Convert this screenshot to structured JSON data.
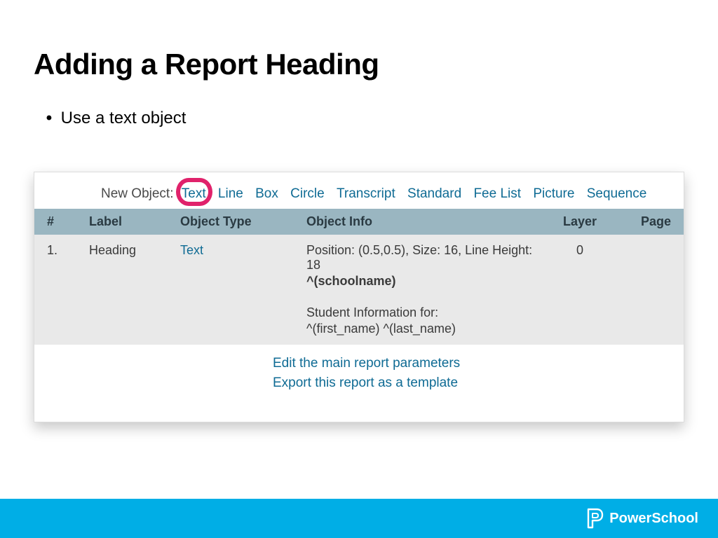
{
  "title": "Adding a Report Heading",
  "bullet": "Use a text object",
  "newObject": {
    "label": "New Object:",
    "types": [
      "Text",
      "Line",
      "Box",
      "Circle",
      "Transcript",
      "Standard",
      "Fee List",
      "Picture",
      "Sequence"
    ],
    "highlighted": "Text"
  },
  "columns": {
    "num": "#",
    "label": "Label",
    "type": "Object Type",
    "info": "Object Info",
    "layer": "Layer",
    "page": "Page"
  },
  "row": {
    "num": "1.",
    "label": "Heading",
    "typeText": "Text",
    "infoLine1": "Position: (0.5,0.5), Size: 16, Line Height: 18",
    "infoTemplate": "^(schoolname)",
    "infoLine3": "Student Information for:",
    "infoLine4": "^(first_name) ^(last_name)",
    "layer": "0",
    "page": ""
  },
  "actions": {
    "edit": "Edit the main report parameters",
    "export": "Export this report as a template"
  },
  "brand": "PowerSchool"
}
